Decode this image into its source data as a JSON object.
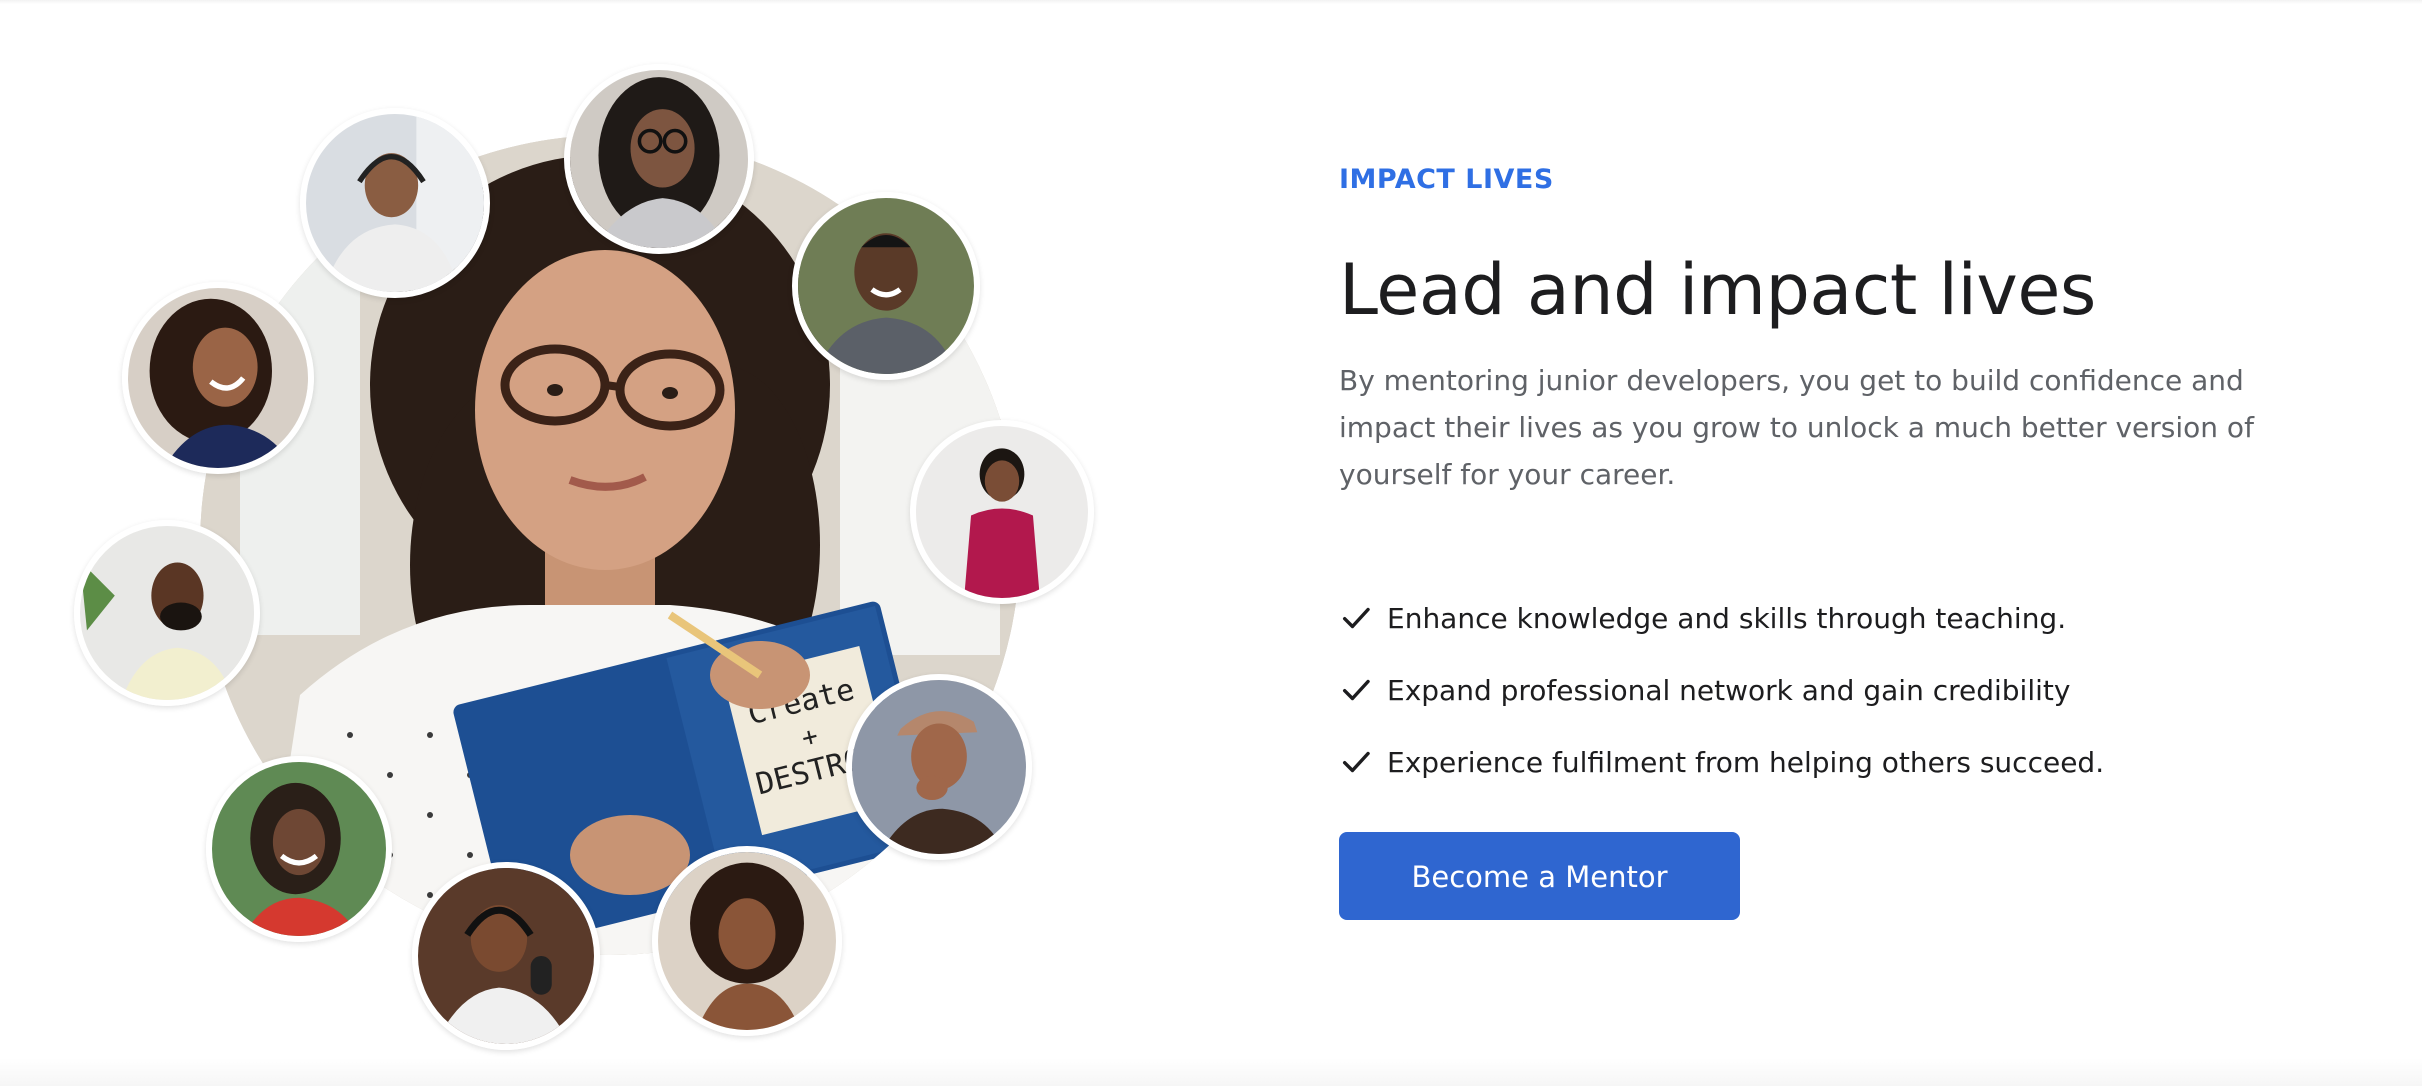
{
  "section": {
    "eyebrow": "IMPACT LIVES",
    "title": "Lead and impact lives",
    "description": "By mentoring junior developers, you get to build confidence and impact their lives as you grow to unlock a much better version of yourself for your career.",
    "benefits": [
      "Enhance knowledge and skills through teaching.",
      "Expand professional network and gain credibility",
      "Experience fulfilment from helping others succeed."
    ],
    "cta_label": "Become a Mentor"
  },
  "icons": {
    "benefit_check": "check-icon"
  },
  "colors": {
    "accent": "#2f6fe4",
    "button": "#2f66d0",
    "heading": "#1d1d1f",
    "body": "#5f6267"
  }
}
